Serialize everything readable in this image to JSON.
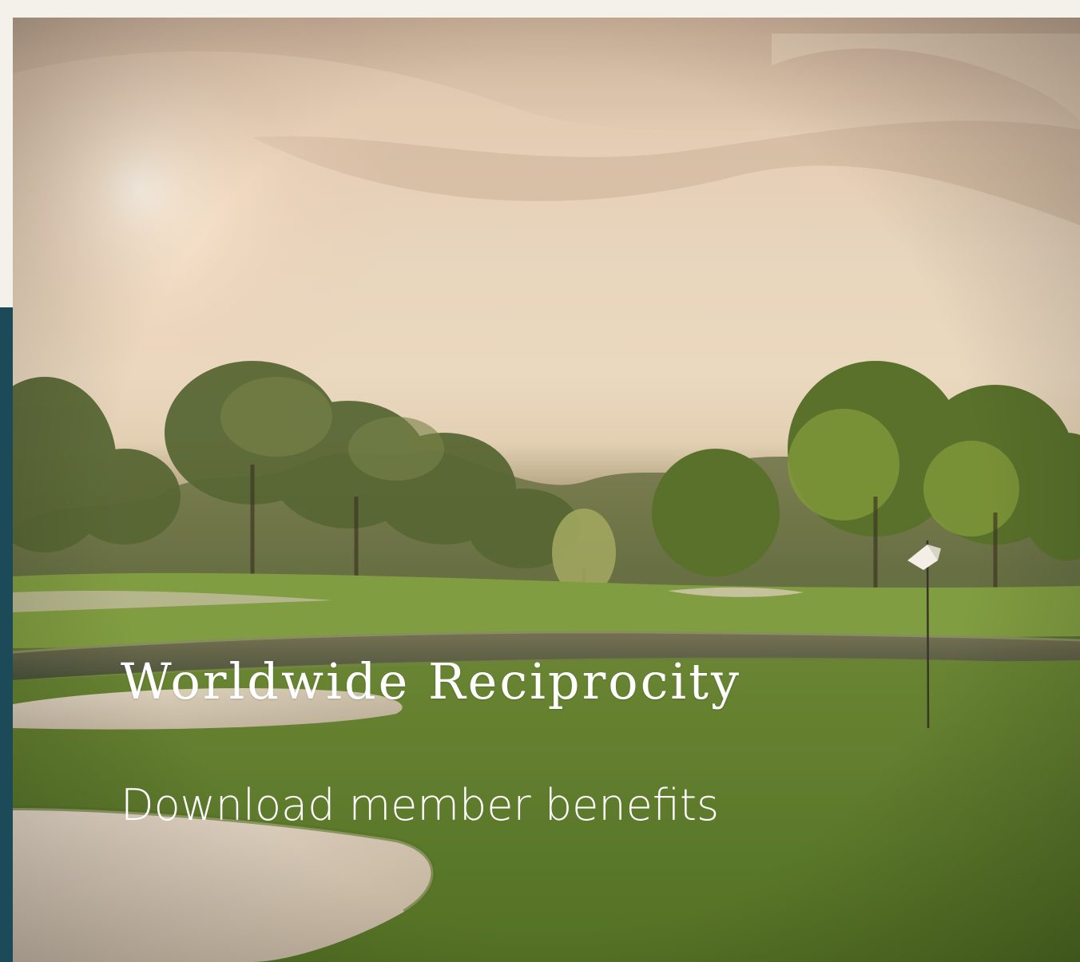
{
  "hero": {
    "title": "Worldwide Reciprocity",
    "link_label": "Download member benefits"
  },
  "colors": {
    "page_background": "#f3f1ea",
    "accent_strip": "#1c4a58",
    "text": "#ffffff"
  },
  "icons": {
    "flag": "golf-flag-icon"
  }
}
